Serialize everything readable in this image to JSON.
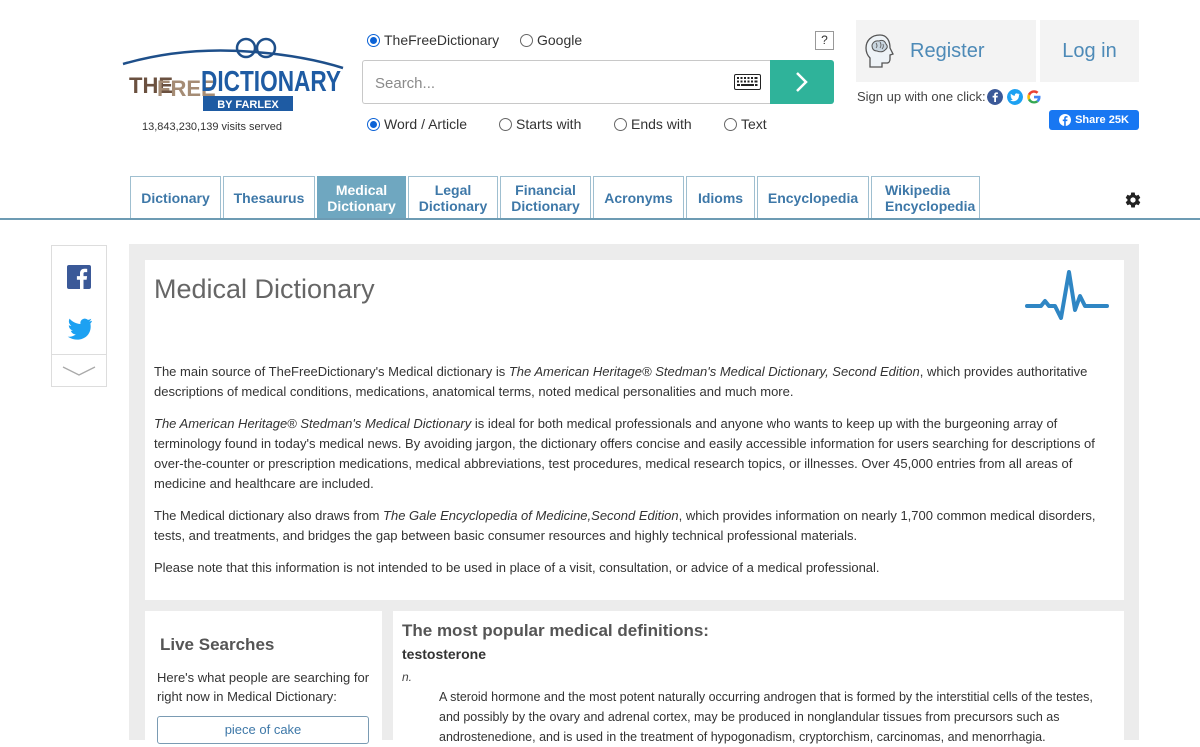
{
  "header": {
    "visits": "13,843,230,139 visits served",
    "engines": [
      "TheFreeDictionary",
      "Google"
    ],
    "engine_selected": 0,
    "help_label": "?",
    "search_placeholder": "Search...",
    "modes": [
      "Word / Article",
      "Starts with",
      "Ends with",
      "Text"
    ],
    "mode_selected": 0,
    "register_label": "Register",
    "login_label": "Log in",
    "signup_text": "Sign up with one click:",
    "share_label": "Share 25K"
  },
  "logo": {
    "the": "THE",
    "free": "FREE",
    "dictionary": "DICTIONARY",
    "by": "BY FARLEX"
  },
  "tabs": [
    {
      "line1": "Dictionary",
      "line2": ""
    },
    {
      "line1": "Thesaurus",
      "line2": ""
    },
    {
      "line1": "Medical",
      "line2": "Dictionary"
    },
    {
      "line1": "Legal",
      "line2": "Dictionary"
    },
    {
      "line1": "Financial",
      "line2": "Dictionary"
    },
    {
      "line1": "Acronyms",
      "line2": ""
    },
    {
      "line1": "Idioms",
      "line2": ""
    },
    {
      "line1": "Encyclopedia",
      "line2": ""
    },
    {
      "line1": "Wikipedia",
      "line2": "Encyclopedia"
    }
  ],
  "active_tab": 2,
  "main": {
    "title": "Medical Dictionary",
    "p1_a": "The main source of TheFreeDictionary's Medical dictionary is ",
    "p1_b": "The American Heritage® Stedman's Medical Dictionary, Second Edition",
    "p1_c": ", which provides authoritative descriptions of medical conditions, medications, anatomical terms, noted medical personalities and much more.",
    "p2_a": "The American Heritage® Stedman's Medical Dictionary",
    "p2_b": " is ideal for both medical professionals and anyone who wants to keep up with the burgeoning array of terminology found in today's medical news. By avoiding jargon, the dictionary offers concise and easily accessible information for users searching for descriptions of over-the-counter or prescription medications, medical abbreviations, test procedures, medical research topics, or illnesses. Over 45,000 entries from all areas of medicine and healthcare are included.",
    "p3_a": "The Medical dictionary also draws from ",
    "p3_b": "The Gale Encyclopedia of Medicine,Second Edition",
    "p3_c": ", which provides information on nearly 1,700 common medical disorders, tests, and treatments, and bridges the gap between basic consumer resources and highly technical professional materials.",
    "p4": "Please note that this information is not intended to be used in place of a visit, consultation, or advice of a medical professional."
  },
  "live": {
    "title": "Live Searches",
    "desc": "Here's what people are searching for right now in Medical Dictionary:",
    "item": "piece of cake"
  },
  "popular": {
    "title": "The most popular medical definitions:",
    "word": "testosterone",
    "pos": "n.",
    "definition": "A steroid hormone and the most potent naturally occurring androgen that is formed by the interstitial cells of the testes, and possibly by the ovary and adrenal cortex, may be produced in nonglandular tissues from precursors such as androstenedione, and is used in the treatment of hypogonadism, cryptorchism, carcinomas, and menorrhagia."
  },
  "colors": {
    "accent": "#2fb39a",
    "link": "#3e78a8",
    "tab_active": "#6fa7c0",
    "facebook": "#1877f2"
  }
}
